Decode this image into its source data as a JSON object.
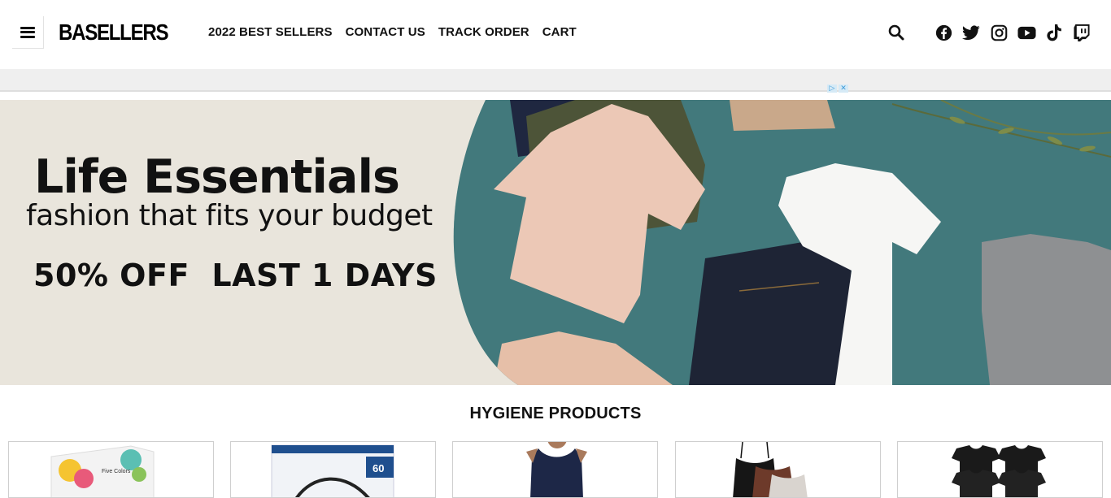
{
  "header": {
    "logo": "BASELLERS",
    "nav": [
      "2022 BEST SELLERS",
      "CONTACT US",
      "TRACK ORDER",
      "CART"
    ],
    "icons": [
      "search-icon",
      "facebook-icon",
      "twitter-icon",
      "instagram-icon",
      "youtube-icon",
      "tiktok-icon",
      "twitch-icon"
    ]
  },
  "ad": {
    "choices": [
      "▷",
      "✕"
    ]
  },
  "banner": {
    "headline": "Life Essentials",
    "subline": "fashion that fits your budget",
    "offer": "50% OFF  LAST 1 DAYS",
    "background_color": "#e9e5dc",
    "photo_color": "#3e7578"
  },
  "section": {
    "title": "HYGIENE PRODUCTS",
    "products": [
      {
        "name": "disposable-masks-box-thumbnail",
        "badge": "Five Colors"
      },
      {
        "name": "kn95-masks-box-thumbnail",
        "badge": "60"
      },
      {
        "name": "navy-tank-top-thumbnail"
      },
      {
        "name": "camisole-set-thumbnail"
      },
      {
        "name": "black-tshirts-pack-thumbnail"
      }
    ]
  }
}
